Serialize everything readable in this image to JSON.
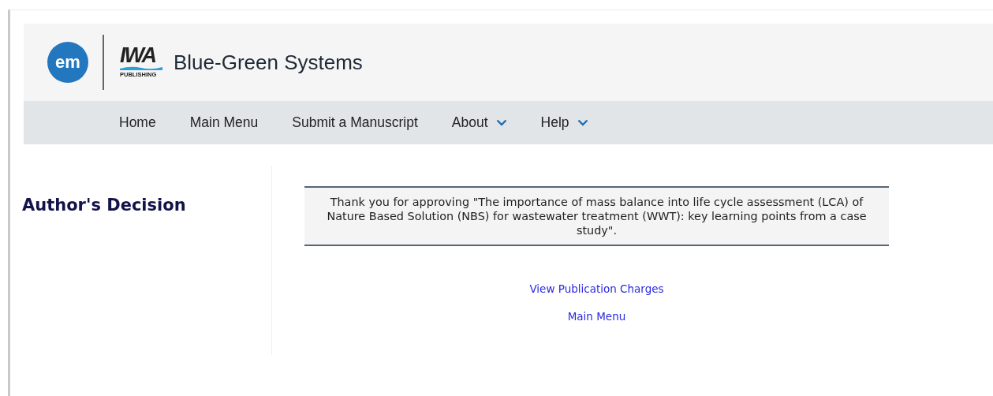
{
  "header": {
    "app_badge": "em",
    "publisher_logo": {
      "mark": "IWA",
      "caption": "PUBLISHING"
    },
    "journal_title": "Blue-Green Systems"
  },
  "nav": [
    {
      "label": "Home",
      "kind": "link"
    },
    {
      "label": "Main Menu",
      "kind": "link"
    },
    {
      "label": "Submit a Manuscript",
      "kind": "link"
    },
    {
      "label": "About",
      "kind": "dropdown"
    },
    {
      "label": "Help",
      "kind": "dropdown"
    }
  ],
  "page_title": "Author's Decision",
  "notice": "Thank you for approving \"The importance of mass balance into life cycle assessment (LCA) of Nature Based Solution (NBS) for wastewater treatment (WWT): key learning points from a case study\".",
  "links": [
    "View Publication Charges",
    "Main Menu"
  ]
}
